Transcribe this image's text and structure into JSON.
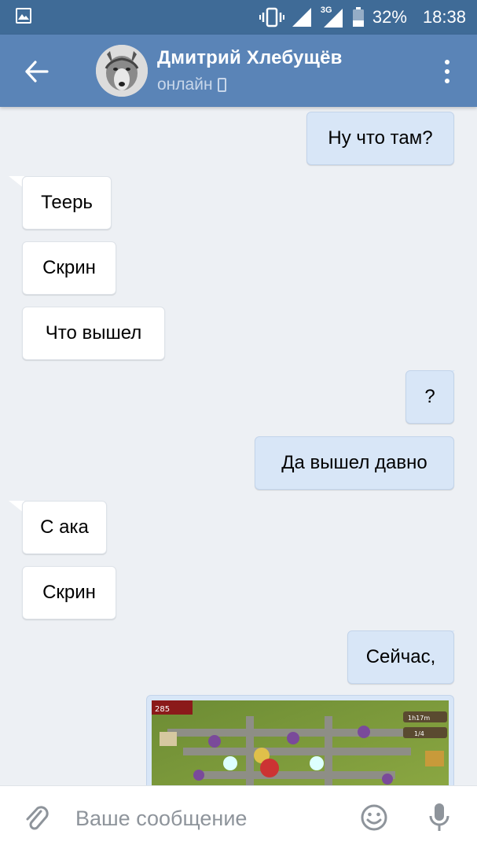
{
  "status_bar": {
    "signal_type": "3G",
    "battery": "32%",
    "time": "18:38",
    "icons": [
      "image-notification-icon",
      "vibrate-icon",
      "signal-icon",
      "network-3g-icon",
      "battery-icon"
    ]
  },
  "header": {
    "contact_name": "Дмитрий Хлебущёв",
    "status": "онлайн",
    "icons": [
      "back-arrow-icon",
      "mobile-phone-icon",
      "more-vertical-icon"
    ]
  },
  "messages": [
    {
      "direction": "out",
      "text": "Ну что там?"
    },
    {
      "direction": "in",
      "text": "Теерь"
    },
    {
      "direction": "in",
      "text": "Скрин"
    },
    {
      "direction": "in",
      "text": "Что вышел"
    },
    {
      "direction": "out",
      "text": "?"
    },
    {
      "direction": "out",
      "text": "Да вышел давно"
    },
    {
      "direction": "in",
      "text": "С ака"
    },
    {
      "direction": "in",
      "text": "Скрин"
    },
    {
      "direction": "out",
      "text": "Сейчас,"
    },
    {
      "direction": "out",
      "type": "image",
      "text": ""
    }
  ],
  "image_overlay": {
    "counter": "285",
    "badge_a": "1h17m",
    "badge_b": "1/4"
  },
  "input": {
    "placeholder": "Ваше сообщение",
    "icons": [
      "paperclip-icon",
      "emoji-icon",
      "microphone-icon"
    ]
  },
  "colors": {
    "status_bar": "#3f6b97",
    "header": "#5a84b7",
    "background": "#edf0f4",
    "bubble_in": "#ffffff",
    "bubble_out": "#d8e6f7",
    "placeholder": "#8e949b"
  }
}
